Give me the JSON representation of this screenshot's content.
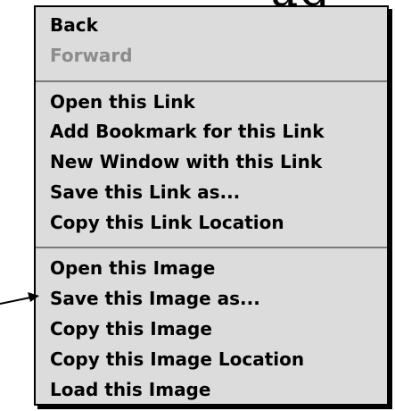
{
  "background": {
    "heading_fragment": "ug"
  },
  "menu": {
    "items": [
      {
        "label": "Back",
        "enabled": true
      },
      {
        "label": "Forward",
        "enabled": false
      },
      {
        "label": "Open this Link",
        "enabled": true
      },
      {
        "label": "Add Bookmark for this Link",
        "enabled": true
      },
      {
        "label": "New Window with this Link",
        "enabled": true
      },
      {
        "label": "Save this Link as...",
        "enabled": true
      },
      {
        "label": "Copy this Link Location",
        "enabled": true
      },
      {
        "label": "Open this Image",
        "enabled": true
      },
      {
        "label": "Save this Image as...",
        "enabled": true
      },
      {
        "label": "Copy this Image",
        "enabled": true
      },
      {
        "label": "Copy this Image Location",
        "enabled": true
      },
      {
        "label": "Load this Image",
        "enabled": true
      }
    ]
  },
  "annotation": {
    "icon": "pointer-arrow-icon",
    "target": "Save this Image as..."
  },
  "colors": {
    "menu_background": "#dcdcdc",
    "disabled_text": "#8c8c8c",
    "separator": "#7a7a7a"
  }
}
